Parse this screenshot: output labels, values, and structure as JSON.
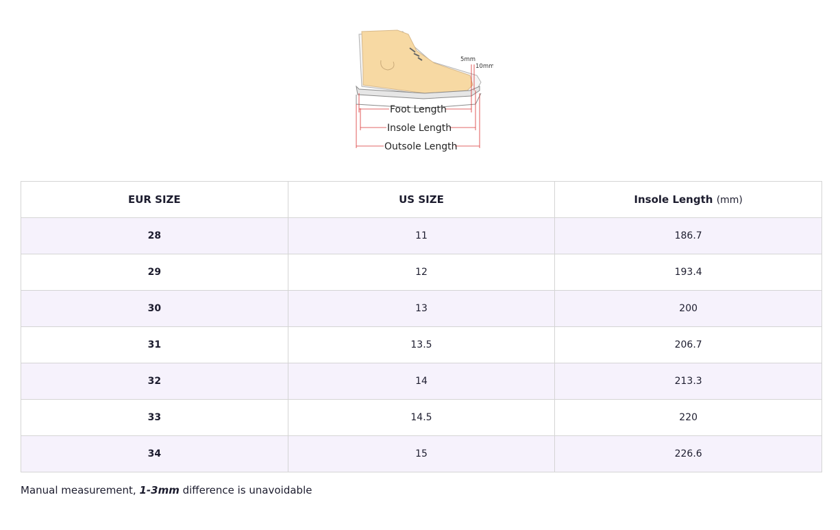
{
  "diagram": {
    "labels": {
      "foot_length": "Foot Length",
      "insole_length": "Insole Length",
      "outsole_length": "Outsole Length",
      "gap_5mm": "5mm",
      "gap_10mm": "10mm"
    }
  },
  "table": {
    "headers": {
      "eur": "EUR SIZE",
      "us": "US SIZE",
      "insole": "Insole Length",
      "insole_unit": "(mm)"
    },
    "rows": [
      {
        "eur": "28",
        "us": "11",
        "insole": "186.7"
      },
      {
        "eur": "29",
        "us": "12",
        "insole": "193.4"
      },
      {
        "eur": "30",
        "us": "13",
        "insole": "200"
      },
      {
        "eur": "31",
        "us": "13.5",
        "insole": "206.7"
      },
      {
        "eur": "32",
        "us": "14",
        "insole": "213.3"
      },
      {
        "eur": "33",
        "us": "14.5",
        "insole": "220"
      },
      {
        "eur": "34",
        "us": "15",
        "insole": "226.6"
      }
    ]
  },
  "note": {
    "prefix": "Manual measurement, ",
    "emphasis": "1-3mm",
    "suffix": " difference is unavoidable"
  },
  "colors": {
    "row_alt": "#f6f2fc",
    "border": "#d4d4d4",
    "measure_line": "#d93030",
    "foot_fill": "#f7d9a3"
  }
}
